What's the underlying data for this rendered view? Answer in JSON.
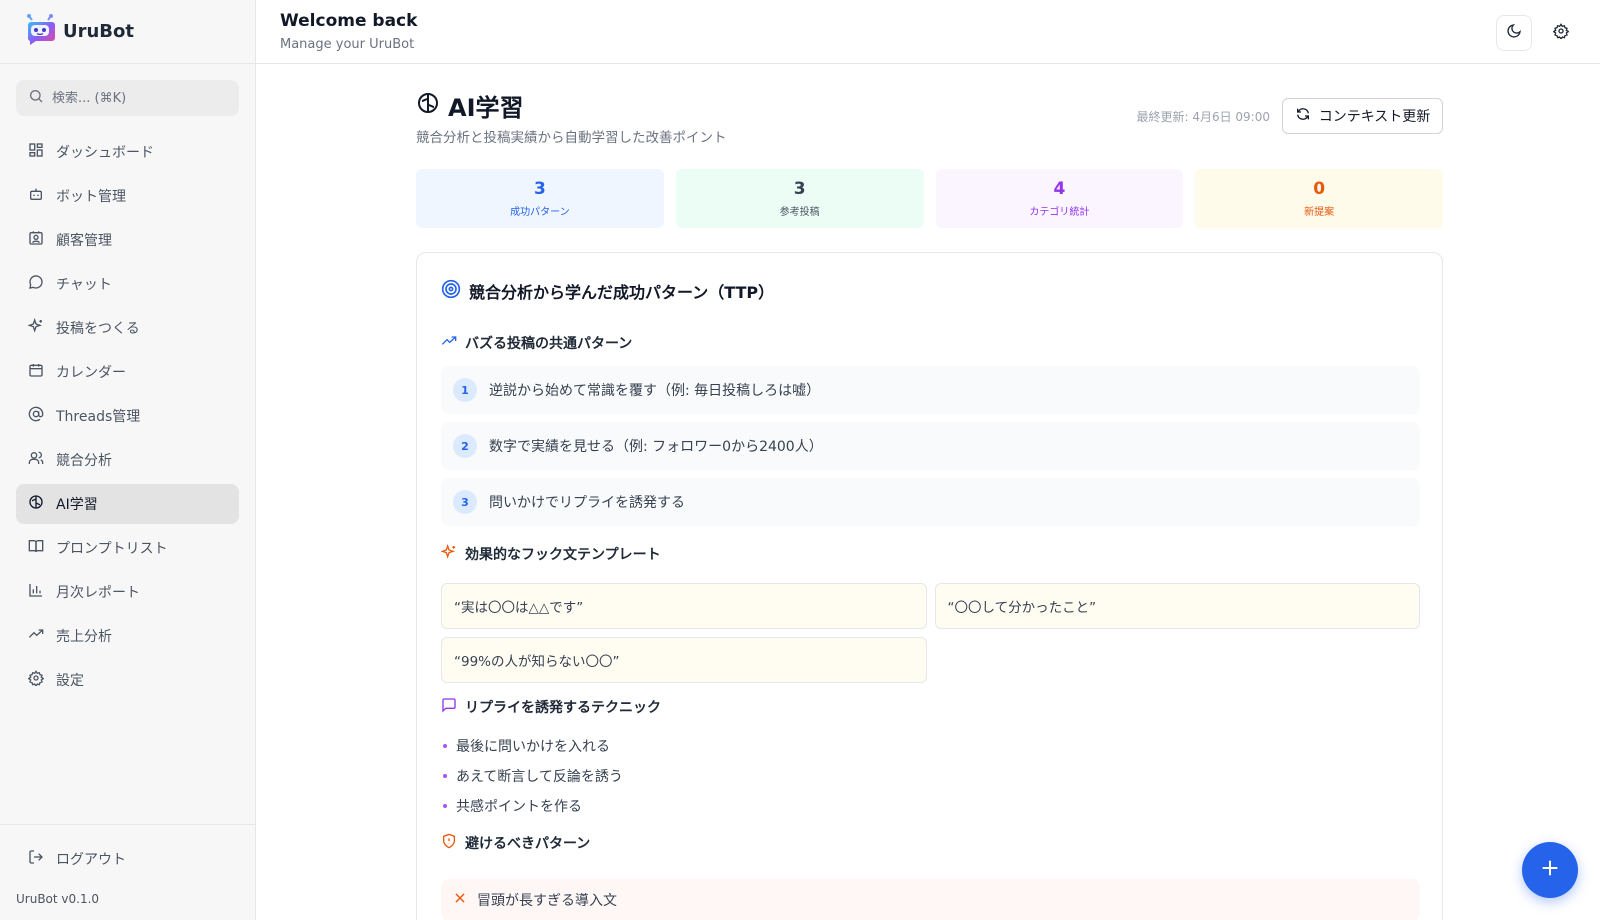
{
  "app": {
    "name": "UruBot",
    "version": "UruBot v0.1.0"
  },
  "search": {
    "placeholder": "検索... (⌘K)"
  },
  "sidebar": {
    "items": [
      {
        "label": "ダッシュボード"
      },
      {
        "label": "ボット管理"
      },
      {
        "label": "顧客管理"
      },
      {
        "label": "チャット"
      },
      {
        "label": "投稿をつくる"
      },
      {
        "label": "カレンダー"
      },
      {
        "label": "Threads管理"
      },
      {
        "label": "競合分析"
      },
      {
        "label": "AI学習",
        "active": true
      },
      {
        "label": "プロンプトリスト"
      },
      {
        "label": "月次レポート"
      },
      {
        "label": "売上分析"
      },
      {
        "label": "設定"
      }
    ],
    "logout_label": "ログアウト"
  },
  "header": {
    "title": "Welcome back",
    "subtitle": "Manage your UruBot"
  },
  "page": {
    "title": "AI学習",
    "subtitle": "競合分析と投稿実績から自動学習した改善ポイント",
    "last_updated": "最終更新: 4月6日 09:00",
    "refresh_label": "コンテキスト更新"
  },
  "stats": [
    {
      "value": "3",
      "label": "成功パターン",
      "color": "#2563eb",
      "bg": "#eff6ff"
    },
    {
      "value": "3",
      "label": "参考投稿",
      "color": "#374151",
      "bg": "#ecfdf5"
    },
    {
      "value": "4",
      "label": "カテゴリ統計",
      "color": "#9333ea",
      "bg": "#faf5ff"
    },
    {
      "value": "0",
      "label": "新提案",
      "color": "#ea580c",
      "bg": "#fffbeb"
    }
  ],
  "card": {
    "title": "競合分析から学んだ成功パターン（TTP）",
    "patterns": {
      "heading": "バズる投稿の共通パターン",
      "items": [
        {
          "num": "1",
          "text": "逆説から始めて常識を覆す（例: 毎日投稿しろは嘘）"
        },
        {
          "num": "2",
          "text": "数字で実績を見せる（例: フォロワー0から2400人）"
        },
        {
          "num": "3",
          "text": "問いかけでリプライを誘発する"
        }
      ]
    },
    "hooks": {
      "heading": "効果的なフック文テンプレート",
      "items": [
        "“実は〇〇は△△です”",
        "“〇〇して分かったこと”",
        "“99%の人が知らない〇〇”"
      ]
    },
    "replies": {
      "heading": "リプライを誘発するテクニック",
      "items": [
        "最後に問いかけを入れる",
        "あえて断言して反論を誘う",
        "共感ポイントを作る"
      ]
    },
    "avoid": {
      "heading": "避けるべきパターン",
      "items": [
        "冒頭が長すぎる導入文"
      ]
    }
  },
  "colors": {
    "accent": "#2563eb",
    "fab": "#2563eb"
  }
}
